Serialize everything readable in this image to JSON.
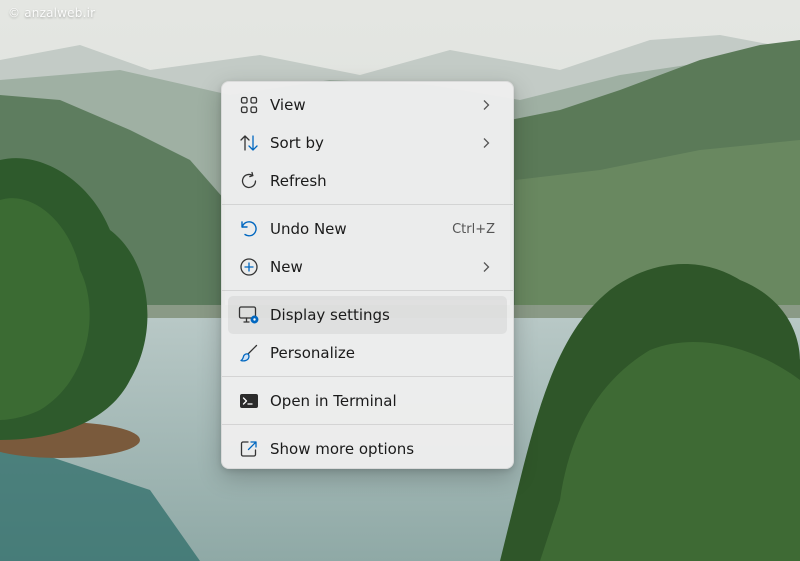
{
  "watermark": "© anzalweb.ir",
  "menu": {
    "groups": [
      [
        {
          "label": "View",
          "icon": "grid-icon",
          "submenu": true
        },
        {
          "label": "Sort by",
          "icon": "sort-arrows-icon",
          "submenu": true
        },
        {
          "label": "Refresh",
          "icon": "refresh-icon",
          "submenu": false
        }
      ],
      [
        {
          "label": "Undo New",
          "icon": "undo-icon",
          "shortcut": "Ctrl+Z",
          "submenu": false
        },
        {
          "label": "New",
          "icon": "plus-circle-icon",
          "submenu": true
        }
      ],
      [
        {
          "label": "Display settings",
          "icon": "display-settings-icon",
          "submenu": false,
          "hovered": true
        },
        {
          "label": "Personalize",
          "icon": "brush-icon",
          "submenu": false
        }
      ],
      [
        {
          "label": "Open in Terminal",
          "icon": "terminal-icon",
          "submenu": false
        }
      ],
      [
        {
          "label": "Show more options",
          "icon": "external-window-icon",
          "submenu": false
        }
      ]
    ]
  },
  "colors": {
    "accent": "#0067c0",
    "menu_background": "#eeeeee",
    "text": "#1b1b1b"
  }
}
